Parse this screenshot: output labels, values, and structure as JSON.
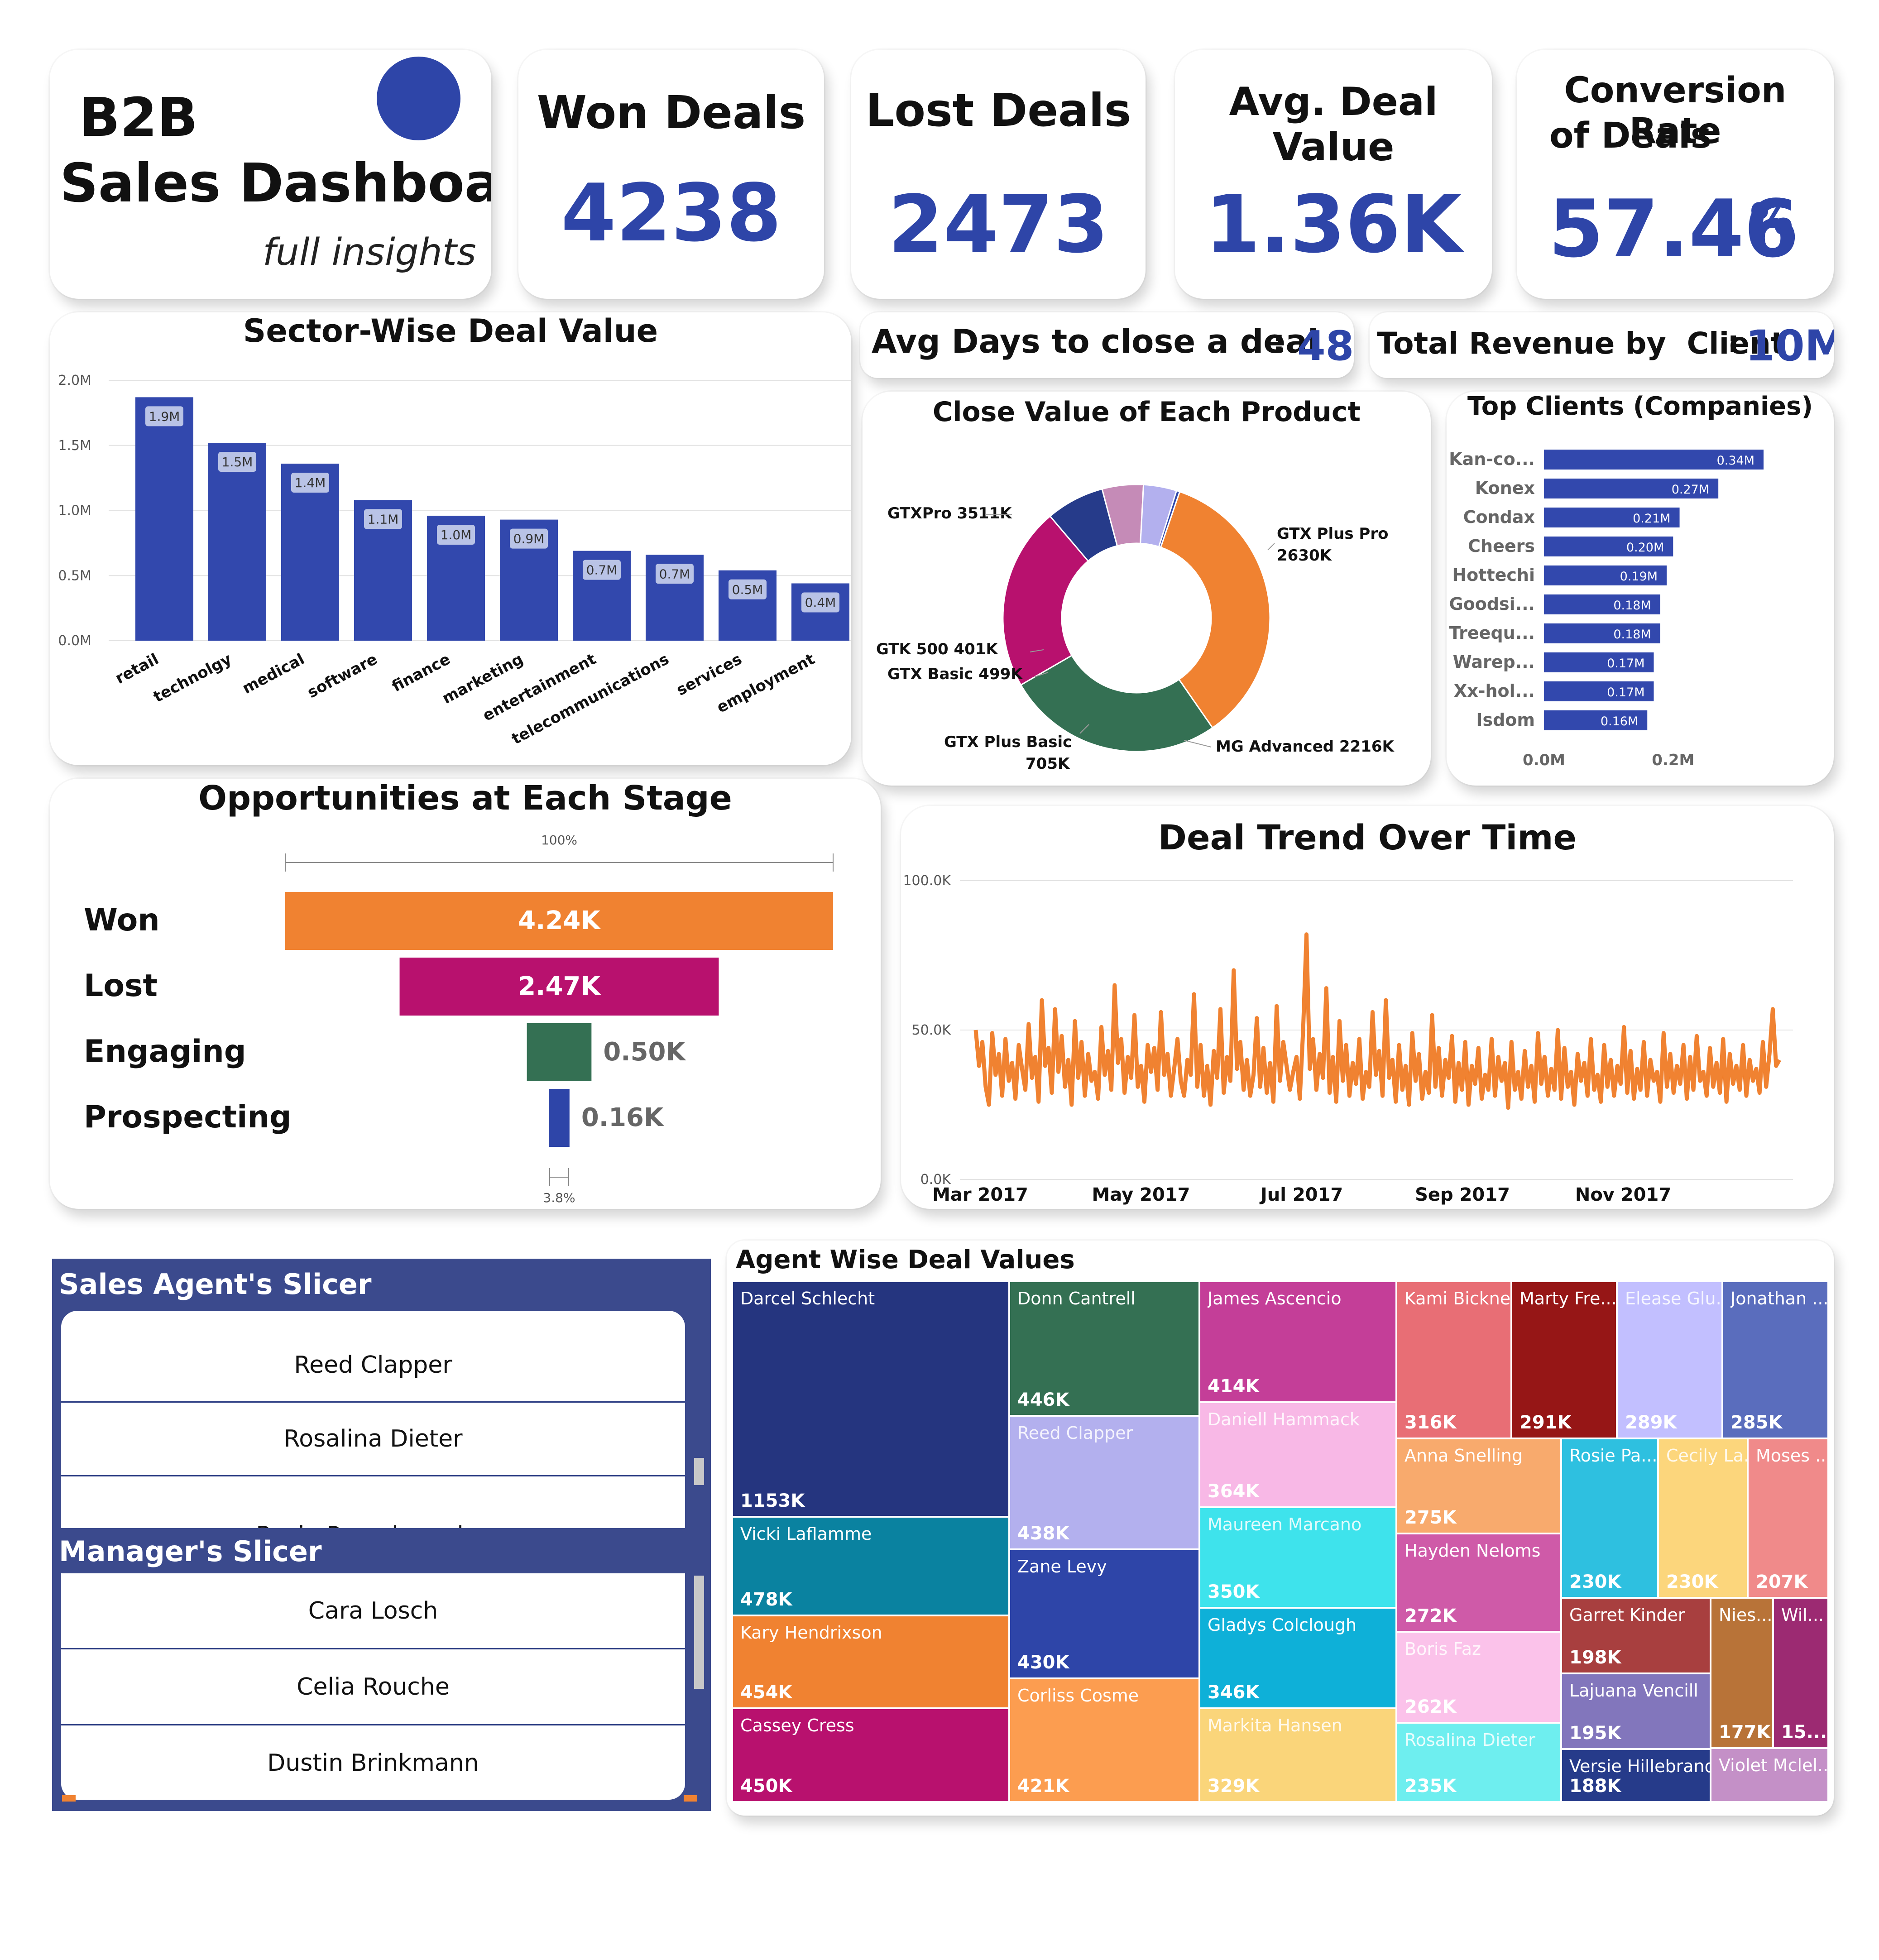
{
  "header": {
    "title_line1": "B2B",
    "title_line2": "Sales Dashboard",
    "subtitle": "full insights",
    "accent_color": "#2e45a8"
  },
  "kpis": {
    "won_deals": {
      "label": "Won Deals",
      "value": "4238"
    },
    "lost_deals": {
      "label": "Lost Deals",
      "value": "2473"
    },
    "avg_deal_value": {
      "label": "Avg. Deal Value",
      "value": "1.36K"
    },
    "conversion_rate": {
      "label_line1": "Conversion Rate",
      "label_line2": "of Deals",
      "value": "57.46",
      "unit": "%"
    },
    "avg_days": {
      "label": "Avg Days to close a deal",
      "separator": ":",
      "value": "48"
    },
    "total_revenue": {
      "label": "Total Revenue by  Client",
      "separator": ":",
      "value": "10M"
    }
  },
  "colors": {
    "primary_blue": "#3248ad",
    "orange": "#f08231",
    "magenta": "#b8116e",
    "green": "#347053",
    "label_bg": "#b9c3e6"
  },
  "chart_data": [
    {
      "id": "sector",
      "type": "bar",
      "title": "Sector-Wise Deal Value",
      "categories": [
        "retail",
        "technolgy",
        "medical",
        "software",
        "finance",
        "marketing",
        "entertainment",
        "telecommunications",
        "services",
        "employment"
      ],
      "values": [
        1.87,
        1.52,
        1.36,
        1.08,
        0.96,
        0.93,
        0.69,
        0.66,
        0.54,
        0.44
      ],
      "data_labels": [
        "1.9M",
        "1.5M",
        "1.4M",
        "1.1M",
        "1.0M",
        "0.9M",
        "0.7M",
        "0.7M",
        "0.5M",
        "0.4M"
      ],
      "y_ticks": [
        "0.0M",
        "0.5M",
        "1.0M",
        "1.5M",
        "2.0M"
      ],
      "ylim": [
        0,
        2.0
      ],
      "grid": true
    },
    {
      "id": "products",
      "type": "pie",
      "title": "Close Value of Each Product",
      "labels": [
        "GTXPro",
        "GTX Plus Pro",
        "MG Advanced",
        "GTX Plus Basic",
        "GTX Basic",
        "GTK 500",
        "GTX 500"
      ],
      "display_labels": [
        "GTXPro 3511K",
        "GTX Plus Pro\n2630K",
        "MG Advanced 2216K",
        "GTX Plus Basic\n705K",
        "GTX Basic 499K",
        "GTK 500 401K",
        ""
      ],
      "values": [
        3511,
        2630,
        2216,
        705,
        499,
        401,
        40
      ],
      "colors": [
        "#f08231",
        "#347053",
        "#b8116e",
        "#263b8a",
        "#c58bb7",
        "#b3b0ee",
        "#2e45a8"
      ]
    },
    {
      "id": "clients",
      "type": "bar",
      "orientation": "horizontal",
      "title": "Top Clients (Companies)",
      "categories": [
        "Kan-co...",
        "Konex",
        "Condax",
        "Cheers",
        "Hottechi",
        "Goodsi...",
        "Treequ...",
        "Warep...",
        "Xx-hol...",
        "Isdom"
      ],
      "values": [
        0.34,
        0.27,
        0.21,
        0.2,
        0.19,
        0.18,
        0.18,
        0.17,
        0.17,
        0.16
      ],
      "data_labels": [
        "0.34M",
        "0.27M",
        "0.21M",
        "0.20M",
        "0.19M",
        "0.18M",
        "0.18M",
        "0.17M",
        "0.17M",
        "0.16M"
      ],
      "x_ticks": [
        "0.0M",
        "0.2M"
      ],
      "xlim": [
        0,
        0.35
      ]
    },
    {
      "id": "funnel",
      "type": "bar",
      "title": "Opportunities at Each Stage",
      "categories": [
        "Won",
        "Lost",
        "Engaging",
        "Prospecting"
      ],
      "values": [
        4.24,
        2.47,
        0.5,
        0.16
      ],
      "data_labels": [
        "4.24K",
        "2.47K",
        "0.50K",
        "0.16K"
      ],
      "colors": [
        "#f08231",
        "#b8116e",
        "#347053",
        "#2e45a8"
      ],
      "top_marker": "100%",
      "bottom_marker": "3.8%"
    },
    {
      "id": "trend",
      "type": "line",
      "title": "Deal Trend Over Time",
      "x_ticks": [
        "Mar 2017",
        "May 2017",
        "Jul 2017",
        "Sep 2017",
        "Nov 2017"
      ],
      "y_ticks": [
        "0.0K",
        "50.0K",
        "100.0K"
      ],
      "ylim": [
        0,
        100
      ],
      "grid": true,
      "series": [
        {
          "color": "#f08231",
          "values": [
            50,
            38,
            46,
            31,
            25,
            49,
            35,
            42,
            28,
            47,
            33,
            39,
            27,
            45,
            37,
            30,
            52,
            34,
            41,
            26,
            60,
            38,
            44,
            29,
            57,
            36,
            48,
            31,
            40,
            25,
            53,
            34,
            46,
            28,
            42,
            33,
            36,
            27,
            51,
            35,
            43,
            30,
            65,
            39,
            47,
            29,
            41,
            34,
            55,
            31,
            38,
            26,
            45,
            36,
            44,
            30,
            56,
            35,
            42,
            28,
            37,
            47,
            33,
            28,
            40,
            35,
            62,
            31,
            45,
            28,
            38,
            25,
            43,
            34,
            57,
            29,
            41,
            33,
            70,
            37,
            46,
            30,
            40,
            28,
            35,
            54,
            31,
            44,
            29,
            39,
            26,
            58,
            33,
            46,
            38,
            30,
            36,
            41,
            27,
            50,
            82,
            37,
            47,
            30,
            42,
            34,
            64,
            29,
            41,
            26,
            53,
            33,
            45,
            28,
            39,
            32,
            47,
            27,
            36,
            31,
            56,
            35,
            43,
            28,
            60,
            34,
            40,
            26,
            45,
            30,
            38,
            25,
            49,
            33,
            42,
            27,
            36,
            29,
            55,
            31,
            44,
            28,
            40,
            34,
            48,
            26,
            39,
            30,
            46,
            25,
            38,
            32,
            44,
            27,
            35,
            30,
            47,
            28,
            41,
            33,
            39,
            24,
            46,
            30,
            36,
            27,
            43,
            31,
            38,
            26,
            49,
            32,
            41,
            28,
            37,
            30,
            50,
            27,
            44,
            31,
            36,
            25,
            42,
            33,
            39,
            28,
            47,
            30,
            35,
            26,
            45,
            31,
            40,
            28,
            38,
            32,
            51,
            29,
            43,
            27,
            37,
            30,
            46,
            28,
            40,
            33,
            36,
            26,
            49,
            31,
            42,
            29,
            38,
            32,
            45,
            27,
            41,
            30,
            48,
            33,
            36,
            28,
            44,
            31,
            39,
            29,
            47,
            26,
            42,
            32,
            38,
            30,
            45,
            28,
            40,
            33,
            37,
            29,
            46,
            31,
            42,
            57,
            38,
            40
          ]
        }
      ]
    },
    {
      "id": "agents",
      "type": "heatmap",
      "title": "Agent Wise Deal Values",
      "labels": [
        "Darcel Schlecht",
        "Vicki Laflamme",
        "Kary Hendrixson",
        "Cassey Cress",
        "Donn Cantrell",
        "Reed Clapper",
        "Zane Levy",
        "Corliss Cosme",
        "James Ascencio",
        "Daniell Hammack",
        "Maureen Marcano",
        "Gladys Colclough",
        "Markita Hansen",
        "Kami Bicknell",
        "Marty Fre...",
        "Elease Glu...",
        "Jonathan ...",
        "Anna Snelling",
        "Hayden Neloms",
        "Boris Faz",
        "Rosalina Dieter",
        "Rosie Pa...",
        "Cecily La...",
        "Moses ...",
        "Garret Kinder",
        "Lajuana Vencill",
        "Versie Hillebrand",
        "Nies...",
        "Wil...",
        "Violet Mclel..."
      ],
      "display_values": [
        "1153K",
        "478K",
        "454K",
        "450K",
        "446K",
        "438K",
        "430K",
        "421K",
        "414K",
        "364K",
        "350K",
        "346K",
        "329K",
        "316K",
        "291K",
        "289K",
        "285K",
        "275K",
        "272K",
        "262K",
        "235K",
        "230K",
        "230K",
        "207K",
        "198K",
        "195K",
        "188K",
        "177K",
        "15...",
        ""
      ],
      "values": [
        1153,
        478,
        454,
        450,
        446,
        438,
        430,
        421,
        414,
        364,
        350,
        346,
        329,
        316,
        291,
        289,
        285,
        275,
        272,
        262,
        235,
        230,
        230,
        207,
        198,
        195,
        188,
        177,
        150,
        140
      ]
    }
  ],
  "slicers": {
    "agent": {
      "title": "Sales Agent's Slicer",
      "items": [
        "Reed Clapper",
        "Rosalina Dieter",
        "Rosie Papadopoulos"
      ]
    },
    "manager": {
      "title": "Manager's Slicer",
      "items": [
        "Cara Losch",
        "Celia Rouche",
        "Dustin Brinkmann"
      ]
    }
  }
}
